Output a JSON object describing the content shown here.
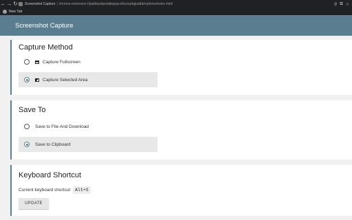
{
  "browser": {
    "tab_title": "Screenshot Capture",
    "url": "chrome-extension://giabbpobpebjfegnpcclkocepbgiadbb/options/index.html",
    "bookmark_new_tab": "New Tab",
    "nav_icons": [
      "back-icon",
      "forward-icon",
      "reload-icon"
    ],
    "right_icons": [
      "zoom-icon",
      "share-icon",
      "bookmark-star-icon"
    ]
  },
  "header": {
    "title": "Screenshot Capture"
  },
  "capture_method": {
    "heading": "Capture Method",
    "options": [
      {
        "label": "Capture Fullscreen",
        "icon": "fullscreen-icon",
        "selected": false
      },
      {
        "label": "Capture Selected Area",
        "icon": "selected-area-icon",
        "selected": true
      }
    ]
  },
  "save_to": {
    "heading": "Save To",
    "options": [
      {
        "label": "Save to File And Download",
        "selected": false
      },
      {
        "label": "Save to Clipboard",
        "selected": true
      }
    ]
  },
  "keyboard_shortcut": {
    "heading": "Keyboard Shortcut",
    "current_label": "Current keyboard shortcut",
    "shortcut": "Alt+S",
    "update_label": "UPDATE"
  },
  "colors": {
    "accent": "#5a7d8f",
    "chrome_bg": "#202124",
    "page_bg": "#f1f1f1",
    "selected_bg": "#e8e8e8"
  }
}
